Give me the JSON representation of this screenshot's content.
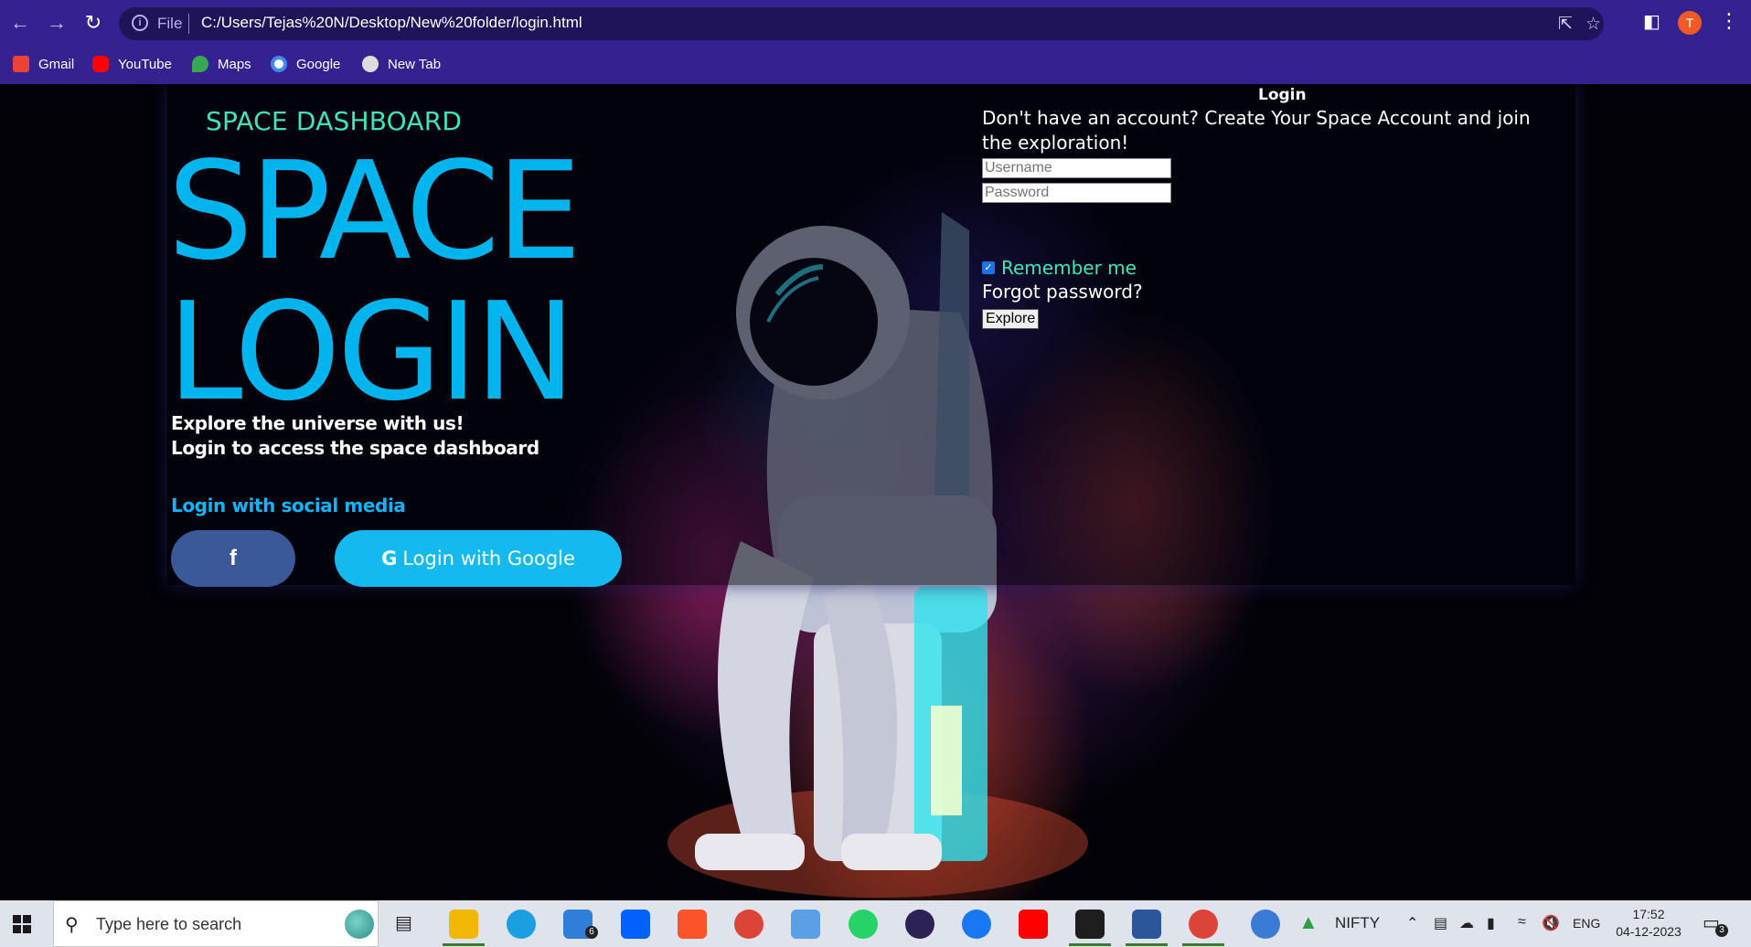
{
  "browser": {
    "file_label": "File",
    "url": "C:/Users/Tejas%20N/Desktop/New%20folder/login.html",
    "profile_initial": "T",
    "bookmarks": [
      {
        "label": "Gmail",
        "icon": "gmail-icon",
        "color": "#ea4335"
      },
      {
        "label": "YouTube",
        "icon": "youtube-icon",
        "color": "#ff0000"
      },
      {
        "label": "Maps",
        "icon": "maps-icon",
        "color": "#34a853"
      },
      {
        "label": "Google",
        "icon": "google-icon",
        "color": "#4285f4"
      },
      {
        "label": "New Tab",
        "icon": "globe-icon",
        "color": "#dddddd"
      }
    ]
  },
  "page": {
    "brand": "SPACE DASHBOARD",
    "hero_line1": "SPACE",
    "hero_line2": "LOGIN",
    "tagline1": "Explore the universe with us!",
    "tagline2": "Login to access the space dashboard",
    "social_heading": "Login with social media",
    "facebook_label": "f",
    "google_icon": "G",
    "google_label": "Login with Google",
    "login_title": "Login",
    "login_desc": "Don't have an account? Create Your Space Account and join the exploration!",
    "username_placeholder": "Username",
    "password_placeholder": "Password",
    "remember_label": "Remember me",
    "remember_checked": true,
    "forgot_label": "Forgot password?",
    "submit_label": "Explore",
    "colors": {
      "accent": "#00b4ee",
      "brand": "#3fe6b4",
      "facebook": "#3b5998",
      "google_btn": "#14b9f0"
    }
  },
  "taskbar": {
    "search_placeholder": "Type here to search",
    "mail_badge": "6",
    "stock_label": "NIFTY",
    "language": "ENG",
    "time": "17:52",
    "date": "04-12-2023",
    "notification_count": "3"
  }
}
